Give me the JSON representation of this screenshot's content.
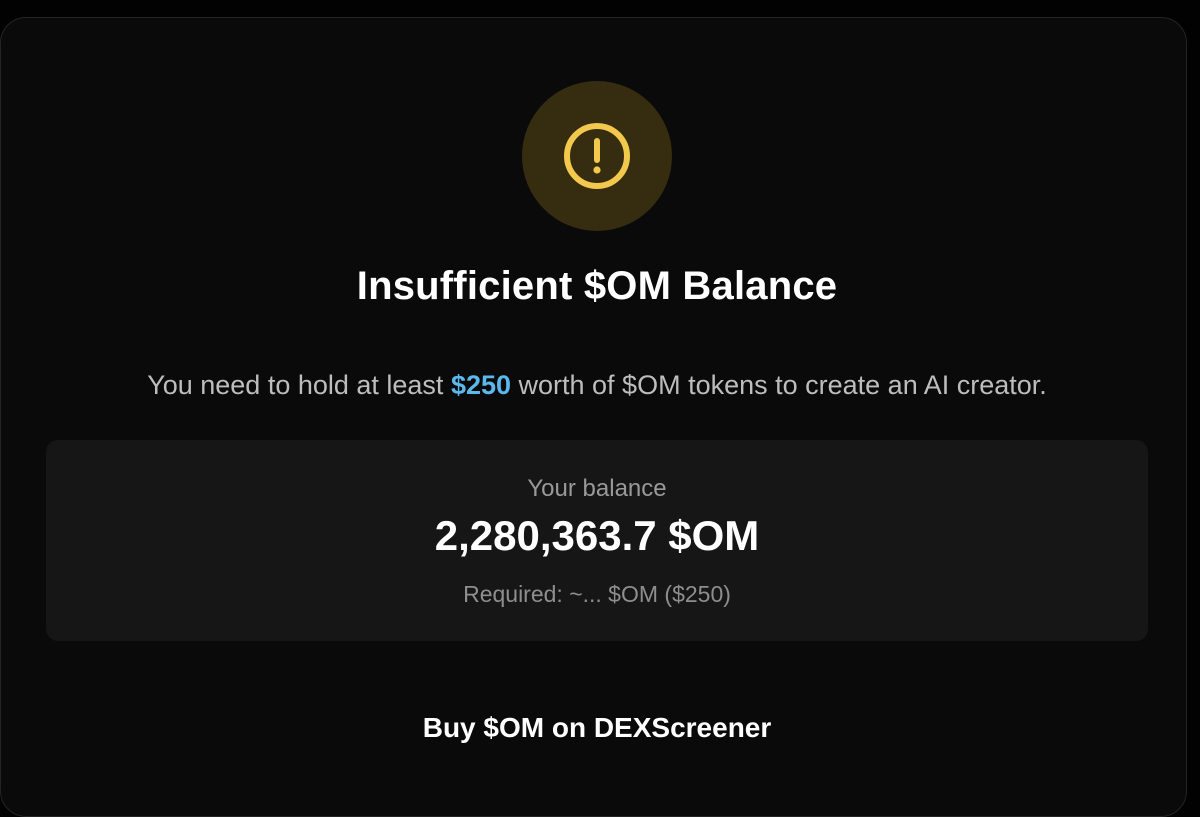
{
  "icon": "warning-circle-icon",
  "colors": {
    "accent": "#5ab8ec",
    "warning": "#f2c94c",
    "warning_bg": "#362d10"
  },
  "modal": {
    "title": "Insufficient $OM Balance",
    "description": {
      "before": "You need to hold at least ",
      "amount": "$250",
      "after": " worth of $OM tokens to create an AI creator."
    },
    "balance": {
      "label": "Your balance",
      "value": "2,280,363.7 $OM",
      "required": "Required: ~... $OM ($250)"
    },
    "buy_label": "Buy $OM on DEXScreener"
  }
}
